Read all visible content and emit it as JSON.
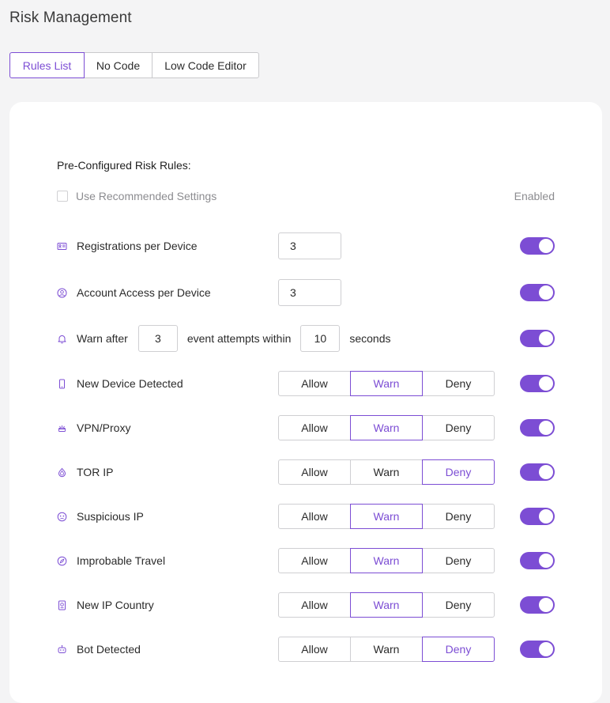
{
  "page": {
    "title": "Risk Management"
  },
  "tabs": [
    {
      "label": "Rules List",
      "active": true
    },
    {
      "label": "No Code",
      "active": false
    },
    {
      "label": "Low Code Editor",
      "active": false
    }
  ],
  "card": {
    "section_title": "Pre-Configured Risk Rules:",
    "recommended_label": "Use Recommended Settings",
    "recommended_checked": false,
    "enabled_header": "Enabled"
  },
  "rules": {
    "registrations": {
      "label": "Registrations per Device",
      "value": "3",
      "icon": "id-card-icon",
      "enabled": true
    },
    "account_access": {
      "label": "Account Access per Device",
      "value": "3",
      "icon": "user-circle-icon",
      "enabled": true
    },
    "warn_after": {
      "prefix": "Warn after",
      "attempts": "3",
      "middle": "event attempts within",
      "seconds": "10",
      "suffix": "seconds",
      "icon": "bell-icon",
      "enabled": true
    },
    "actions": {
      "allow": "Allow",
      "warn": "Warn",
      "deny": "Deny"
    },
    "segmented": [
      {
        "label": "New Device Detected",
        "icon": "mobile-device-icon",
        "selected": "Warn",
        "enabled": true
      },
      {
        "label": "VPN/Proxy",
        "icon": "vpn-icon",
        "selected": "Warn",
        "enabled": true
      },
      {
        "label": "TOR IP",
        "icon": "tor-onion-icon",
        "selected": "Deny",
        "enabled": true
      },
      {
        "label": "Suspicious IP",
        "icon": "suspicious-ip-icon",
        "selected": "Warn",
        "enabled": true
      },
      {
        "label": "Improbable Travel",
        "icon": "compass-icon",
        "selected": "Warn",
        "enabled": true
      },
      {
        "label": "New IP Country",
        "icon": "passport-icon",
        "selected": "Warn",
        "enabled": true
      },
      {
        "label": "Bot Detected",
        "icon": "robot-icon",
        "selected": "Deny",
        "enabled": true
      }
    ]
  },
  "colors": {
    "accent": "#7c4dd4",
    "muted_text": "#8c8c90",
    "border": "#cfcfd2"
  }
}
